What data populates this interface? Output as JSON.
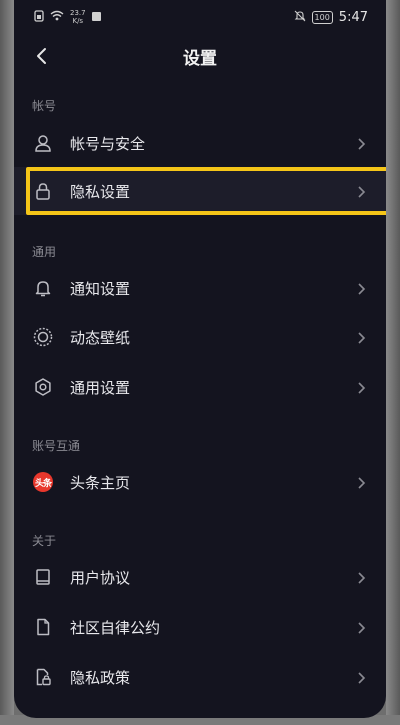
{
  "status_bar": {
    "speed_value": "23.7",
    "speed_unit": "K/s",
    "battery": "100",
    "time": "5:47"
  },
  "header": {
    "title": "设置"
  },
  "sections": {
    "account": {
      "label": "帐号",
      "items": [
        {
          "label": "帐号与安全",
          "icon": "person-icon"
        },
        {
          "label": "隐私设置",
          "icon": "lock-icon"
        }
      ]
    },
    "general": {
      "label": "通用",
      "items": [
        {
          "label": "通知设置",
          "icon": "bell-icon"
        },
        {
          "label": "动态壁纸",
          "icon": "wallpaper-icon"
        },
        {
          "label": "通用设置",
          "icon": "gear-icon"
        }
      ]
    },
    "linked": {
      "label": "账号互通",
      "items": [
        {
          "label": "头条主页",
          "icon": "toutiao-logo-icon",
          "logo_text": "头条"
        }
      ]
    },
    "about": {
      "label": "关于",
      "items": [
        {
          "label": "用户协议",
          "icon": "book-icon"
        },
        {
          "label": "社区自律公约",
          "icon": "document-icon"
        },
        {
          "label": "隐私政策",
          "icon": "privacy-doc-icon"
        }
      ]
    }
  },
  "colors": {
    "background": "#14141f",
    "highlight_border": "#f5c518",
    "section_label": "#8a8a92",
    "text": "#e8e8ec"
  }
}
